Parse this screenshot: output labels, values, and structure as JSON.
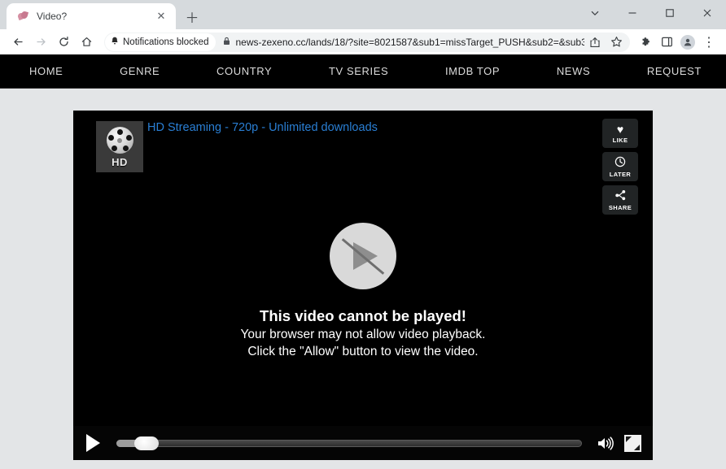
{
  "browser": {
    "tab": {
      "title": "Video?",
      "favicon_icon": "paw-favicon",
      "close_icon": "✕"
    },
    "new_tab_icon": "＋",
    "window_controls": {
      "tab_search_icon": "ˇ",
      "minimize_icon": "—",
      "maximize_icon": "□",
      "close_icon": "✕"
    },
    "toolbar": {
      "back_icon": "←",
      "forward_icon": "→",
      "reload_icon": "⟳",
      "home_icon": "⌂",
      "notifications_chip": {
        "bell_icon": "🔔",
        "label": "Notifications blocked"
      },
      "lock_icon": "🔒",
      "url": "news-zexeno.cc/lands/18/?site=8021587&sub1=missTarget_PUSH&sub2=&sub3...",
      "share_icon": "⤴",
      "bookmark_icon": "☆",
      "extensions_icon": "🧩",
      "side_panel_icon": "□",
      "profile_icon": "👤",
      "menu_icon": "⋮"
    }
  },
  "site_nav": {
    "items": [
      {
        "label": "HOME"
      },
      {
        "label": "GENRE"
      },
      {
        "label": "COUNTRY"
      },
      {
        "label": "TV SERIES"
      },
      {
        "label": "IMDB TOP"
      },
      {
        "label": "NEWS"
      },
      {
        "label": "REQUEST"
      }
    ]
  },
  "player": {
    "thumbnail": {
      "icon": "film-reel-icon",
      "quality_label": "HD"
    },
    "title": "HD Streaming - 720p - Unlimited downloads",
    "side_buttons": [
      {
        "icon": "♥",
        "icon_name": "heart-icon",
        "label": "LIKE"
      },
      {
        "icon": "🕒",
        "icon_name": "clock-icon",
        "label": "LATER"
      },
      {
        "icon": "⁂",
        "icon_name": "share-nodes-icon",
        "label": "SHARE"
      }
    ],
    "error": {
      "play_icon": "play-blocked-icon",
      "heading": "This video cannot be played!",
      "line1": "Your browser may not allow video playback.",
      "line2": "Click the \"Allow\" button to view the video."
    },
    "controls": {
      "play_icon": "play-icon",
      "seek_label": "seek-bar",
      "volume_icon": "🔊",
      "fullscreen_icon": "fullscreen-icon"
    }
  },
  "colors": {
    "page_bg": "#e3e5e7",
    "chrome_bg": "#d6dadd",
    "player_bg": "#000000",
    "title_blue": "#2a7fd4",
    "nav_text": "#dcdcdc"
  }
}
